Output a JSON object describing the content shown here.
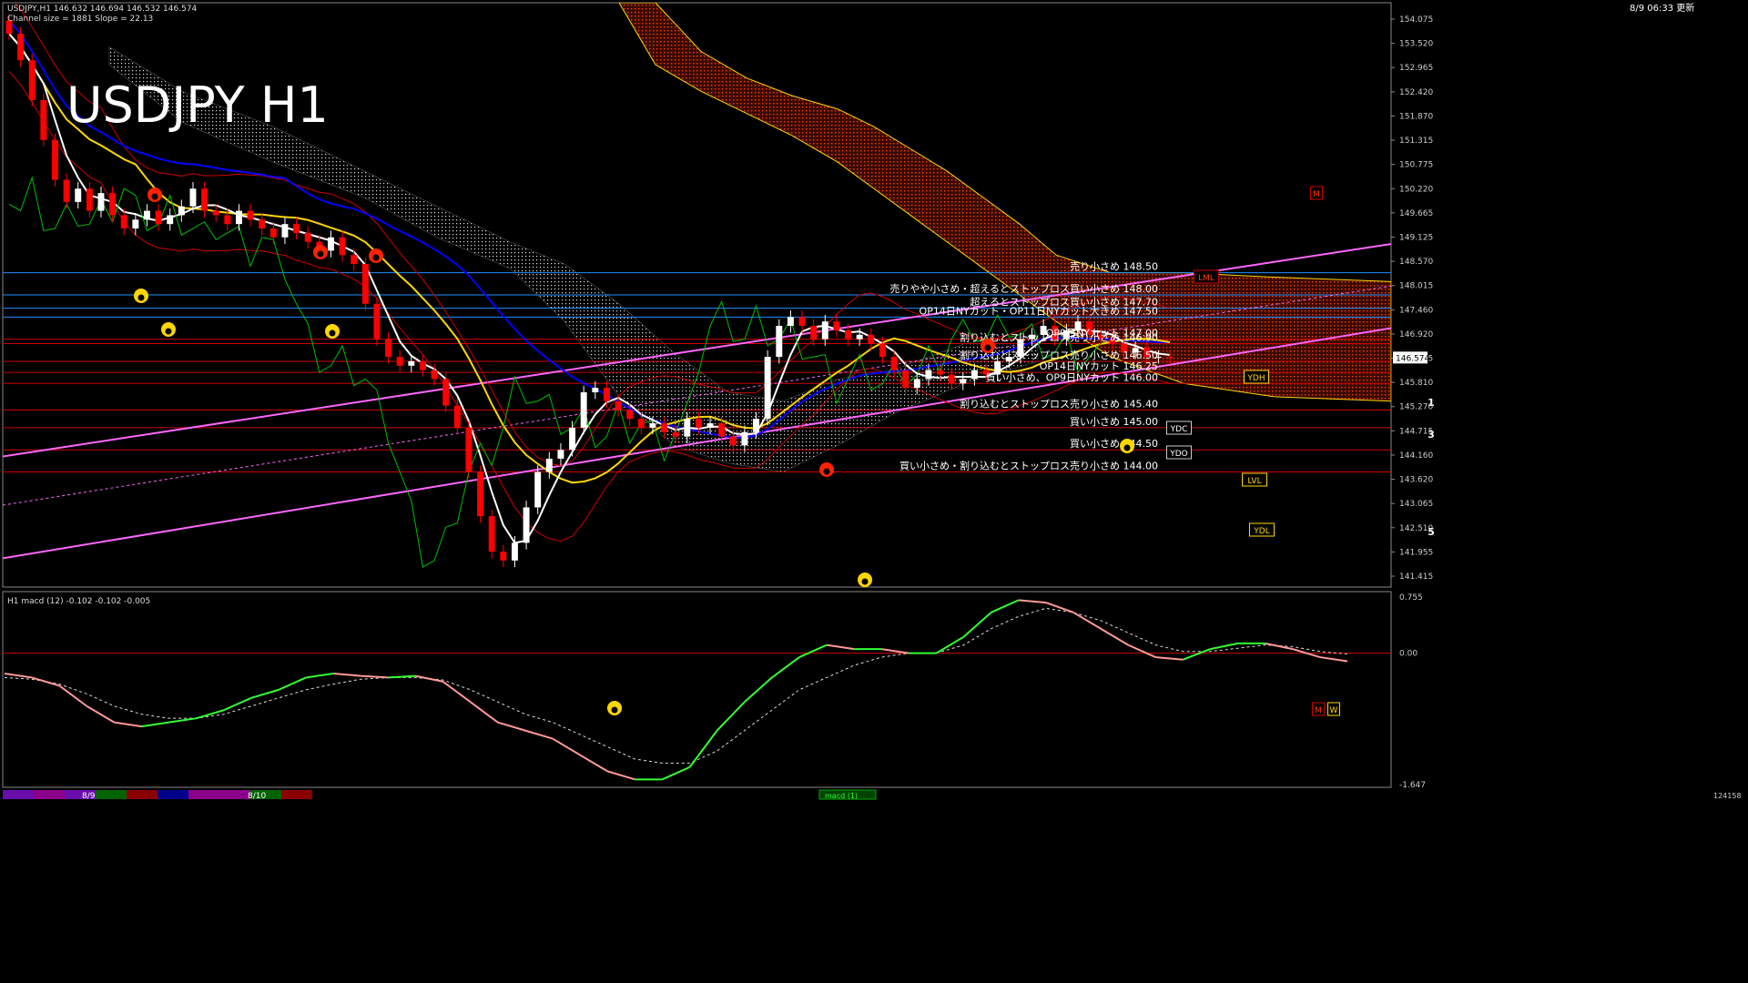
{
  "header": {
    "info_line": "USDJPY,H1  146.632 146.694 146.532 146.574",
    "channel_line": "Channel size = 1881 Slope = 22.13",
    "big_title": "USDJPY H1",
    "datetime": "8/9  06:33  更新"
  },
  "colors": {
    "background": "#000000",
    "bull": "#ffffff",
    "bear": "#ff0000",
    "sma_short": "#ffffff",
    "sma_mid": "#ffd700",
    "sma_long": "#0000ff",
    "bollinger": "#cc0000",
    "chikou": "#00c000",
    "channel": "#ff66ff",
    "cloud_red": "#ff3b00",
    "cloud_white": "#ffffff",
    "level_red": "#cc0000",
    "level_blue": "#1e90ff",
    "macd_up": "#33ff33",
    "macd_down": "#ff9999",
    "macd_zero": "#cc0000"
  },
  "chart_data": [
    {
      "type": "candlestick",
      "title": "USDJPY H1",
      "ylim": [
        141.4,
        154.6
      ],
      "y_ticks": [
        "154.075",
        "153.520",
        "152.965",
        "152.420",
        "151.870",
        "151.315",
        "150.775",
        "150.220",
        "149.665",
        "149.125",
        "148.570",
        "148.015",
        "147.460",
        "146.920",
        "146.365",
        "145.810",
        "145.270",
        "144.715",
        "144.160",
        "143.620",
        "143.065",
        "142.510",
        "141.955",
        "141.415"
      ],
      "current_price": "146.574",
      "closes": [
        153.9,
        153.3,
        152.4,
        151.5,
        150.6,
        150.1,
        150.4,
        149.9,
        150.3,
        149.8,
        149.5,
        149.7,
        149.9,
        149.6,
        149.8,
        150.0,
        150.4,
        149.9,
        149.8,
        149.6,
        149.9,
        149.7,
        149.5,
        149.3,
        149.6,
        149.4,
        149.2,
        149.0,
        149.3,
        148.9,
        148.7,
        147.8,
        147.0,
        146.6,
        146.4,
        146.5,
        146.3,
        146.1,
        145.5,
        145.0,
        144.0,
        143.0,
        142.2,
        142.0,
        142.4,
        143.2,
        144.0,
        144.3,
        144.5,
        145.0,
        145.8,
        145.9,
        145.6,
        145.4,
        145.2,
        145.0,
        145.1,
        144.9,
        144.8,
        145.2,
        145.0,
        145.1,
        144.8,
        144.6,
        144.9,
        145.2,
        146.6,
        147.3,
        147.5,
        147.3,
        147.0,
        147.4,
        147.2,
        147.0,
        147.1,
        146.9,
        146.6,
        146.3,
        145.9,
        146.1,
        146.3,
        146.2,
        146.0,
        146.1,
        146.3,
        146.2,
        146.5,
        146.6,
        147.0,
        147.1,
        147.3,
        147.0,
        147.2,
        147.4,
        147.1,
        147.0,
        146.9,
        146.7,
        146.8,
        146.6,
        146.6,
        146.574
      ],
      "levels": [
        {
          "price": 148.5,
          "label": "売り小さめ 148.50"
        },
        {
          "price": 148.0,
          "label": "売りやや小さめ・超えるとストップロス買い小さめ 148.00"
        },
        {
          "price": 147.7,
          "label": "超えるとストップロス買い小さめ 147.70"
        },
        {
          "price": 147.5,
          "label": "OP14日NYカット・OP11日NYカット大きめ 147.50"
        },
        {
          "price": 147.0,
          "label": "OP9日NYカット 147.00"
        },
        {
          "price": 146.9,
          "label": "割り込むとストップロス売り小さめ 146.90"
        },
        {
          "price": 146.5,
          "label": "割り込むとストップロス売り小さめ 146.50"
        },
        {
          "price": 146.25,
          "label": "OP14日NYカット 146.25"
        },
        {
          "price": 146.0,
          "label": "買い小さめ、OP9日NYカット 146.00"
        },
        {
          "price": 145.4,
          "label": "割り込むとストップロス売り小さめ 145.40"
        },
        {
          "price": 145.0,
          "label": "買い小さめ 145.00"
        },
        {
          "price": 144.5,
          "label": "買い小さめ 144.50"
        },
        {
          "price": 144.0,
          "label": "買い小さめ・割り込むとストップロス売り小さめ 144.00"
        }
      ],
      "tags": [
        "M",
        "LML",
        "YDH",
        "YDC",
        "YDO",
        "LVL",
        "YDL",
        "M",
        "W",
        "1",
        "3",
        "5"
      ]
    },
    {
      "type": "line",
      "title": "H1  macd (12) -0.102 -0.102 -0.005",
      "ylim": [
        -1.647,
        0.755
      ],
      "y_ticks": [
        "0.755",
        "0.00",
        "-1.647"
      ],
      "series": [
        {
          "values": [
            -0.25,
            -0.3,
            -0.4,
            -0.65,
            -0.85,
            -0.9,
            -0.85,
            -0.8,
            -0.7,
            -0.55,
            -0.45,
            -0.3,
            -0.25,
            -0.28,
            -0.3,
            -0.28,
            -0.35,
            -0.6,
            -0.85,
            -0.95,
            -1.05,
            -1.25,
            -1.45,
            -1.55,
            -1.55,
            -1.4,
            -0.95,
            -0.6,
            -0.3,
            -0.05,
            0.1,
            0.05,
            0.05,
            0.0,
            0.0,
            0.2,
            0.5,
            0.65,
            0.62,
            0.5,
            0.3,
            0.1,
            -0.05,
            -0.08,
            0.05,
            0.12,
            0.12,
            0.05,
            -0.05,
            -0.1
          ]
        },
        {
          "values": [
            -0.3,
            -0.32,
            -0.38,
            -0.5,
            -0.65,
            -0.75,
            -0.8,
            -0.8,
            -0.75,
            -0.65,
            -0.55,
            -0.45,
            -0.38,
            -0.32,
            -0.3,
            -0.3,
            -0.33,
            -0.45,
            -0.6,
            -0.75,
            -0.85,
            -1.0,
            -1.15,
            -1.3,
            -1.35,
            -1.35,
            -1.2,
            -0.95,
            -0.7,
            -0.45,
            -0.3,
            -0.15,
            -0.05,
            0.0,
            0.0,
            0.1,
            0.3,
            0.45,
            0.55,
            0.5,
            0.4,
            0.25,
            0.1,
            0.02,
            0.02,
            0.06,
            0.1,
            0.08,
            0.02,
            -0.01
          ]
        }
      ]
    }
  ],
  "footer": {
    "dates": [
      "8/9",
      "8/10"
    ],
    "tag": "macd (1)",
    "right_number": "124158"
  }
}
